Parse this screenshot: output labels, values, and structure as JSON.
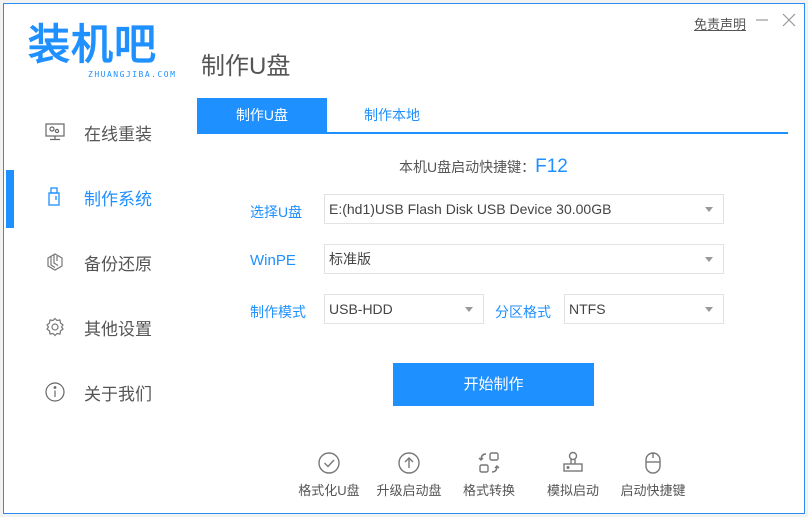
{
  "app": {
    "logo_text": "装机吧",
    "logo_subtext": "ZHUANGJIBA.COM",
    "brand_color": "#1e90ff"
  },
  "window_controls": {
    "disclaimer": "免责声明",
    "minimize_icon": "minimize-icon",
    "close_icon": "close-icon"
  },
  "page_title": "制作U盘",
  "sidebar": {
    "items": [
      {
        "label": "在线重装",
        "icon": "monitor-icon",
        "active": false
      },
      {
        "label": "制作系统",
        "icon": "usb-drive-icon",
        "active": true
      },
      {
        "label": "备份还原",
        "icon": "backup-cube-icon",
        "active": false
      },
      {
        "label": "其他设置",
        "icon": "gear-icon",
        "active": false
      },
      {
        "label": "关于我们",
        "icon": "info-icon",
        "active": false
      }
    ]
  },
  "tabs": [
    {
      "label": "制作U盘",
      "active": true
    },
    {
      "label": "制作本地",
      "active": false
    }
  ],
  "hotkey": {
    "label": "本机U盘启动快捷键：",
    "key": "F12"
  },
  "form": {
    "usb_label": "选择U盘",
    "usb_value": "E:(hd1)USB Flash Disk USB Device 30.00GB",
    "winpe_label": "WinPE",
    "winpe_value": "标准版",
    "mode_label": "制作模式",
    "mode_value": "USB-HDD",
    "partition_label": "分区格式",
    "partition_value": "NTFS"
  },
  "start_button": "开始制作",
  "tools": [
    {
      "label": "格式化U盘",
      "icon": "check-circle-icon"
    },
    {
      "label": "升级启动盘",
      "icon": "upload-circle-icon"
    },
    {
      "label": "格式转换",
      "icon": "convert-icon"
    },
    {
      "label": "模拟启动",
      "icon": "stamp-icon"
    },
    {
      "label": "启动快捷键",
      "icon": "mouse-icon"
    }
  ]
}
